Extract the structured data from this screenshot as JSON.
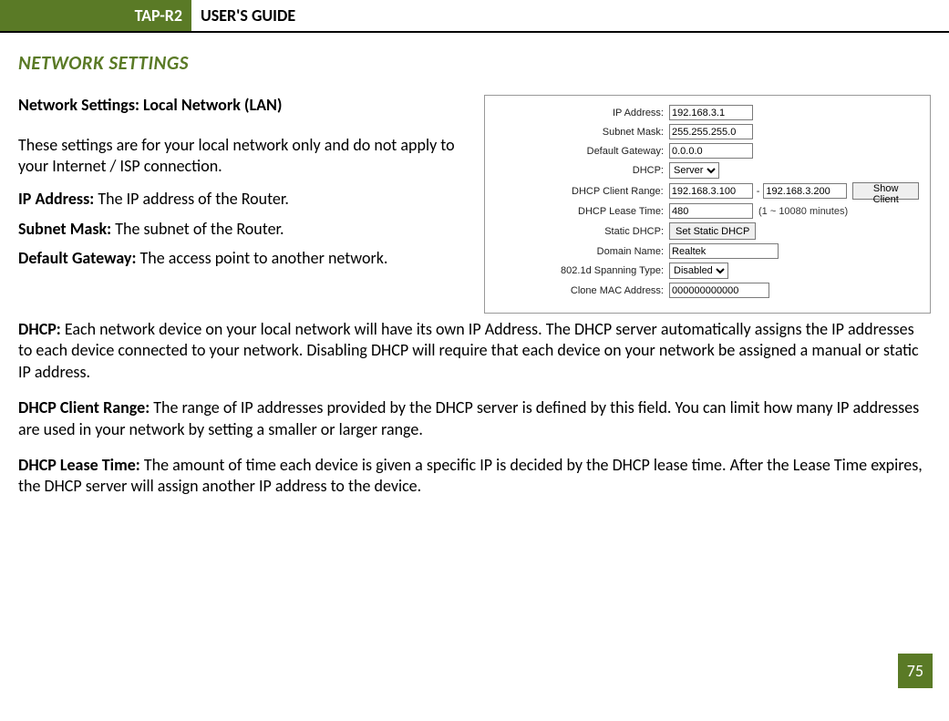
{
  "header": {
    "badge": "TAP-R2",
    "title": "USER'S GUIDE"
  },
  "section_title": "NETWORK SETTINGS",
  "subhead": "Network Settings: Local Network (LAN)",
  "intro": "These settings are for your local network only and do not apply to your Internet / ISP connection.",
  "defs_short": [
    {
      "term": "IP Address:",
      "text": " The IP address of the Router."
    },
    {
      "term": "Subnet Mask:",
      "text": " The subnet of the Router."
    },
    {
      "term": "Default Gateway:",
      "text": " The access point to another network."
    }
  ],
  "defs_full": [
    {
      "term": "DHCP:",
      "text": " Each network device on your local network will have its own IP Address.  The DHCP server automatically assigns the IP addresses to each device connected to your network.  Disabling DHCP will require that each device on your network be assigned a manual or static IP address."
    },
    {
      "term": "DHCP Client Range:",
      "text": " The range of IP addresses provided by the DHCP server is defined by this field.  You can limit how many IP addresses are used in your network by setting a smaller or larger range."
    },
    {
      "term": "DHCP Lease Time:",
      "text": " The amount of time each device is given a specific IP is decided by the DHCP lease time.  After the Lease Time expires, the DHCP server will assign another IP address to the device."
    }
  ],
  "panel": {
    "rows": {
      "ip_address": {
        "label": "IP Address:",
        "value": "192.168.3.1"
      },
      "subnet_mask": {
        "label": "Subnet Mask:",
        "value": "255.255.255.0"
      },
      "default_gateway": {
        "label": "Default Gateway:",
        "value": "0.0.0.0"
      },
      "dhcp": {
        "label": "DHCP:",
        "value": "Server"
      },
      "dhcp_range": {
        "label": "DHCP Client Range:",
        "start": "192.168.3.100",
        "end": "192.168.3.200",
        "button": "Show Client"
      },
      "dhcp_lease": {
        "label": "DHCP Lease Time:",
        "value": "480",
        "hint": "(1 ~ 10080 minutes)"
      },
      "static_dhcp": {
        "label": "Static DHCP:",
        "button": "Set Static DHCP"
      },
      "domain_name": {
        "label": "Domain Name:",
        "value": "Realtek"
      },
      "spanning": {
        "label": "802.1d Spanning Type:",
        "value": "Disabled"
      },
      "clone_mac": {
        "label": "Clone MAC Address:",
        "value": "000000000000"
      }
    }
  },
  "page_number": "75"
}
